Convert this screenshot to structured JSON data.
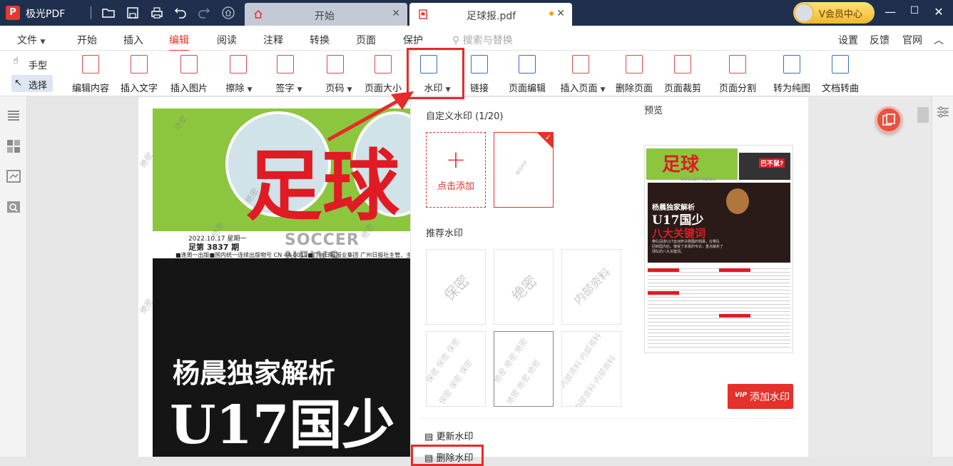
{
  "app": {
    "name": "极光PDF",
    "logo_letter": "P"
  },
  "tabs": [
    {
      "label": "开始",
      "active": false
    },
    {
      "label": "足球报.pdf",
      "active": true
    }
  ],
  "member": {
    "label": "V会员中心"
  },
  "window": {
    "minimize": "—",
    "maximize": "☐",
    "close": "✕"
  },
  "menu": {
    "file": "文件",
    "items": [
      "开始",
      "插入",
      "编辑",
      "阅读",
      "注释",
      "转换",
      "页面",
      "保护"
    ],
    "active": "编辑",
    "search_placeholder": "搜索与替换",
    "right": [
      "设置",
      "反馈",
      "官网"
    ],
    "collapse": "︿"
  },
  "toolbar": {
    "hand": "手型",
    "select": "选择",
    "tools": [
      "编辑内容",
      "插入文字",
      "插入图片",
      "擦除",
      "签字",
      "页码",
      "页面大小",
      "水印",
      "链接",
      "页面编辑",
      "插入页面",
      "删除页面",
      "页面裁剪",
      "页面分割",
      "转为纯图",
      "文档转曲"
    ]
  },
  "document": {
    "title_chars": "足球",
    "date": "2022.10.17 星期一",
    "issue": "足第 3837 期",
    "soccer_news": "SOCCER NEWS",
    "info": "■逢周一出版■国内统一连续出版物号 CN 44-0019■广州日报报业集团 广州日报社主管、主办",
    "headline1": "杨晨独家解析",
    "headline2": "U17国少",
    "watermark": "绝密"
  },
  "watermark_panel": {
    "custom_title": "自定义水印 (1/20)",
    "add_label": "点击添加",
    "custom_thumb_text": "极光PDF",
    "recommended_title": "推荐水印",
    "recommended": [
      "保密",
      "绝密",
      "内部资料",
      "保密 保密 保密",
      "绝密 绝密 绝密",
      "内部资料 内部资料"
    ],
    "preview_title": "预览",
    "add_button": "添加水印",
    "add_button_badge": "VIP",
    "update": "更新水印",
    "delete": "删除水印"
  },
  "preview": {
    "paper_title": "足球",
    "soccer_news": "SOCCER NEWS",
    "red_banner": "巴不鼠?",
    "headline1": "杨晨独家解析",
    "headline2": "U17国少",
    "headline3": "八大关键词",
    "body": "带队闯进U17亚洲杯决赛圈的杨晨，在带队回到国内后，接受了本报的专访，重点解析了球队的八大关键词。"
  }
}
